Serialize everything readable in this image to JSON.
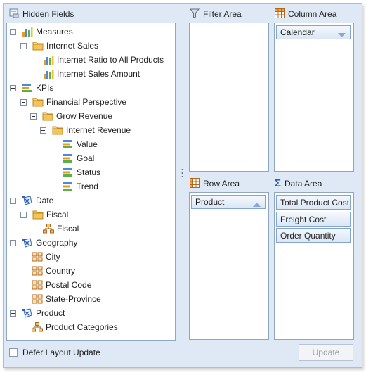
{
  "hidden_fields": {
    "header": "Hidden Fields",
    "tree": [
      {
        "label": "Measures",
        "icon": "measures-icon"
      },
      {
        "label": "Internet Sales",
        "icon": "folder-icon"
      },
      {
        "label": "Internet Ratio to All Products",
        "icon": "measure-icon"
      },
      {
        "label": "Internet Sales Amount",
        "icon": "measure-icon"
      },
      {
        "label": "KPIs",
        "icon": "kpi-icon"
      },
      {
        "label": "Financial Perspective",
        "icon": "folder-icon"
      },
      {
        "label": "Grow Revenue",
        "icon": "folder-icon"
      },
      {
        "label": "Internet Revenue",
        "icon": "folder-icon"
      },
      {
        "label": "Value",
        "icon": "kpi-icon"
      },
      {
        "label": "Goal",
        "icon": "kpi-icon"
      },
      {
        "label": "Status",
        "icon": "kpi-icon"
      },
      {
        "label": "Trend",
        "icon": "kpi-icon"
      },
      {
        "label": "Date",
        "icon": "dimension-icon"
      },
      {
        "label": "Fiscal",
        "icon": "folder-icon"
      },
      {
        "label": "Fiscal",
        "icon": "hierarchy-icon"
      },
      {
        "label": "Geography",
        "icon": "dimension-icon"
      },
      {
        "label": "City",
        "icon": "attribute-icon"
      },
      {
        "label": "Country",
        "icon": "attribute-icon"
      },
      {
        "label": "Postal Code",
        "icon": "attribute-icon"
      },
      {
        "label": "State-Province",
        "icon": "attribute-icon"
      },
      {
        "label": "Product",
        "icon": "dimension-icon"
      },
      {
        "label": "Product Categories",
        "icon": "hierarchy-icon"
      }
    ]
  },
  "filter_area": {
    "header": "Filter Area",
    "fields": []
  },
  "column_area": {
    "header": "Column Area",
    "fields": [
      "Calendar"
    ]
  },
  "row_area": {
    "header": "Row Area",
    "fields": [
      "Product"
    ]
  },
  "data_area": {
    "header": "Data Area",
    "fields": [
      "Total Product Cost",
      "Freight Cost",
      "Order Quantity"
    ]
  },
  "footer": {
    "defer_label": "Defer Layout Update",
    "defer_checked": false,
    "update_label": "Update",
    "update_enabled": false
  },
  "colors": {
    "panel_bg": "#dfe9f5",
    "border": "#8da7c4",
    "folder": "#f2c45a"
  }
}
